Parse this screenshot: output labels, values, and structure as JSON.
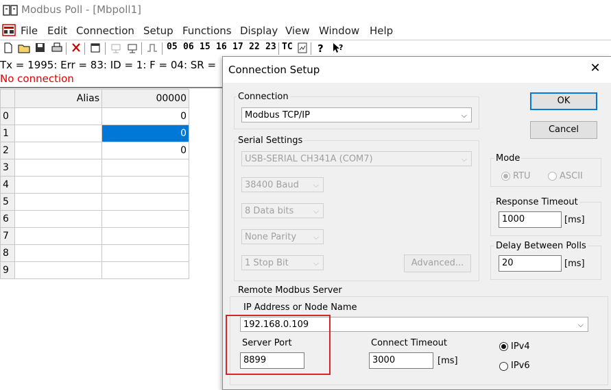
{
  "window": {
    "title": "Modbus Poll - [Mbpoll1]"
  },
  "menu": [
    "File",
    "Edit",
    "Connection",
    "Setup",
    "Functions",
    "Display",
    "View",
    "Window",
    "Help"
  ],
  "toolbar": {
    "function_codes": [
      "05",
      "06",
      "15",
      "16",
      "17",
      "22",
      "23"
    ],
    "tc_label": "TC"
  },
  "status": {
    "line1": "Tx = 1995: Err = 83: ID = 1: F = 04: SR =",
    "line2": "No connection"
  },
  "grid": {
    "alias_header": "Alias",
    "value_header": "00000",
    "rows": [
      {
        "index": "0",
        "value": "0"
      },
      {
        "index": "1",
        "value": "0"
      },
      {
        "index": "2",
        "value": "0"
      },
      {
        "index": "3",
        "value": ""
      },
      {
        "index": "4",
        "value": ""
      },
      {
        "index": "5",
        "value": ""
      },
      {
        "index": "6",
        "value": ""
      },
      {
        "index": "7",
        "value": ""
      },
      {
        "index": "8",
        "value": ""
      },
      {
        "index": "9",
        "value": ""
      }
    ],
    "selected_row": 1
  },
  "dialog": {
    "title": "Connection Setup",
    "connection": {
      "label": "Connection",
      "value": "Modbus TCP/IP"
    },
    "serial": {
      "label": "Serial Settings",
      "port": "USB-SERIAL CH341A (COM7)",
      "baud": "38400 Baud",
      "data_bits": "8 Data bits",
      "parity": "None Parity",
      "stop_bits": "1 Stop Bit",
      "advanced_label": "Advanced..."
    },
    "ok_label": "OK",
    "cancel_label": "Cancel",
    "mode": {
      "label": "Mode",
      "rtu": "RTU",
      "ascii": "ASCII"
    },
    "response_timeout": {
      "label": "Response Timeout",
      "value": "1000",
      "unit": "[ms]"
    },
    "delay_polls": {
      "label": "Delay Between Polls",
      "value": "20",
      "unit": "[ms]"
    },
    "remote": {
      "label": "Remote Modbus Server",
      "ip_label": "IP Address or Node Name",
      "ip_value": "192.168.0.109",
      "port_label": "Server Port",
      "port_value": "8899",
      "connect_timeout_label": "Connect Timeout",
      "connect_timeout_value": "3000",
      "connect_timeout_unit": "[ms]",
      "ipv4": "IPv4",
      "ipv6": "IPv6"
    }
  },
  "colors": {
    "accent": "#0078d7",
    "error_text": "#e00000",
    "highlight_box": "#d9222a"
  }
}
